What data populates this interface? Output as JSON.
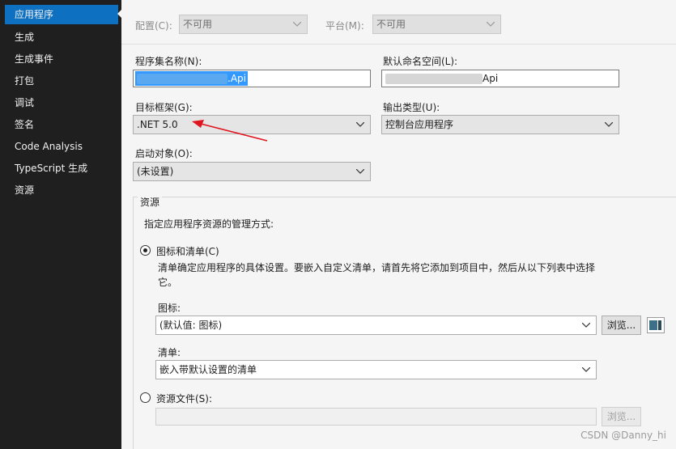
{
  "sidebar": {
    "items": [
      {
        "label": "应用程序"
      },
      {
        "label": "生成"
      },
      {
        "label": "生成事件"
      },
      {
        "label": "打包"
      },
      {
        "label": "调试"
      },
      {
        "label": "签名"
      },
      {
        "label": "Code Analysis"
      },
      {
        "label": "TypeScript 生成"
      },
      {
        "label": "资源"
      }
    ]
  },
  "toolbar": {
    "config_label": "配置(C):",
    "config_value": "不可用",
    "platform_label": "平台(M):",
    "platform_value": "不可用"
  },
  "form": {
    "assembly_label": "程序集名称(N):",
    "assembly_suffix": ".Api",
    "namespace_label": "默认命名空间(L):",
    "namespace_suffix": "Api",
    "framework_label": "目标框架(G):",
    "framework_value": ".NET 5.0",
    "output_label": "输出类型(U):",
    "output_value": "控制台应用程序",
    "startup_label": "启动对象(O):",
    "startup_value": "(未设置)"
  },
  "resources": {
    "group_title": "资源",
    "instruction": "指定应用程序资源的管理方式:",
    "option_icon_manifest": "图标和清单(C)",
    "description": "清单确定应用程序的具体设置。要嵌入自定义清单，请首先将它添加到项目中，然后从以下列表中选择它。",
    "icon_label": "图标:",
    "icon_value": "(默认值: 图标)",
    "browse_label": "浏览...",
    "manifest_label": "清单:",
    "manifest_value": "嵌入带默认设置的清单",
    "option_resource_file": "资源文件(S):",
    "browse_disabled_label": "浏览..."
  },
  "watermark": "CSDN @Danny_hi",
  "colors": {
    "sidebar_bg": "#1f1f1f",
    "accent": "#0e70c0",
    "annotation_arrow": "#e0141e"
  }
}
